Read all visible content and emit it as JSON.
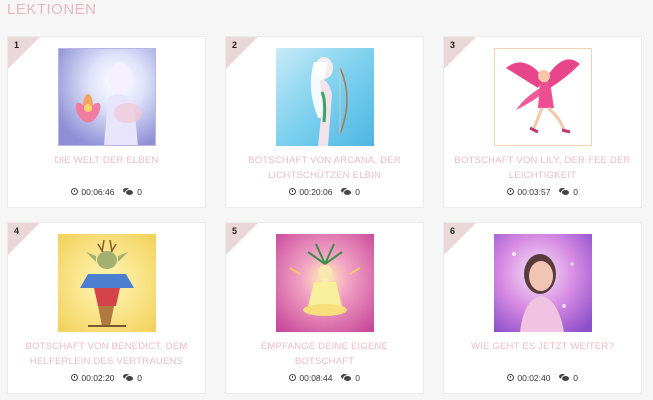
{
  "page": {
    "title": "LEKTIONEN"
  },
  "lessons": [
    {
      "number": "1",
      "title": "DIE WELT DER ELBEN",
      "duration": "00:06:46",
      "comments": "0"
    },
    {
      "number": "2",
      "title": "BOTSCHAFT VON ARCANA, DER LICHTSCHÜTZEN ELBIN",
      "duration": "00:20:06",
      "comments": "0"
    },
    {
      "number": "3",
      "title": "BOTSCHAFT VON LILY, DER FEE DER LEICHTIGKEIT",
      "duration": "00:03:57",
      "comments": "0"
    },
    {
      "number": "4",
      "title": "BOTSCHAFT VON BENEDICT, DEM HELFERLEIN DES VERTRAUENS",
      "duration": "00:02:20",
      "comments": "0"
    },
    {
      "number": "5",
      "title": "EMPFANGE DEINE EIGENE BOTSCHAFT",
      "duration": "00:08:44",
      "comments": "0"
    },
    {
      "number": "6",
      "title": "WIE GEHT ES JETZT WEITER?",
      "duration": "00:02:40",
      "comments": "0"
    }
  ],
  "images": [
    {
      "icon": "elf-lotus-painting"
    },
    {
      "icon": "archer-elf-painting"
    },
    {
      "icon": "pink-fairy-illustration"
    },
    {
      "icon": "benedict-helper-drawing"
    },
    {
      "icon": "meditating-figure-painting"
    },
    {
      "icon": "woman-portrait-photo"
    }
  ]
}
